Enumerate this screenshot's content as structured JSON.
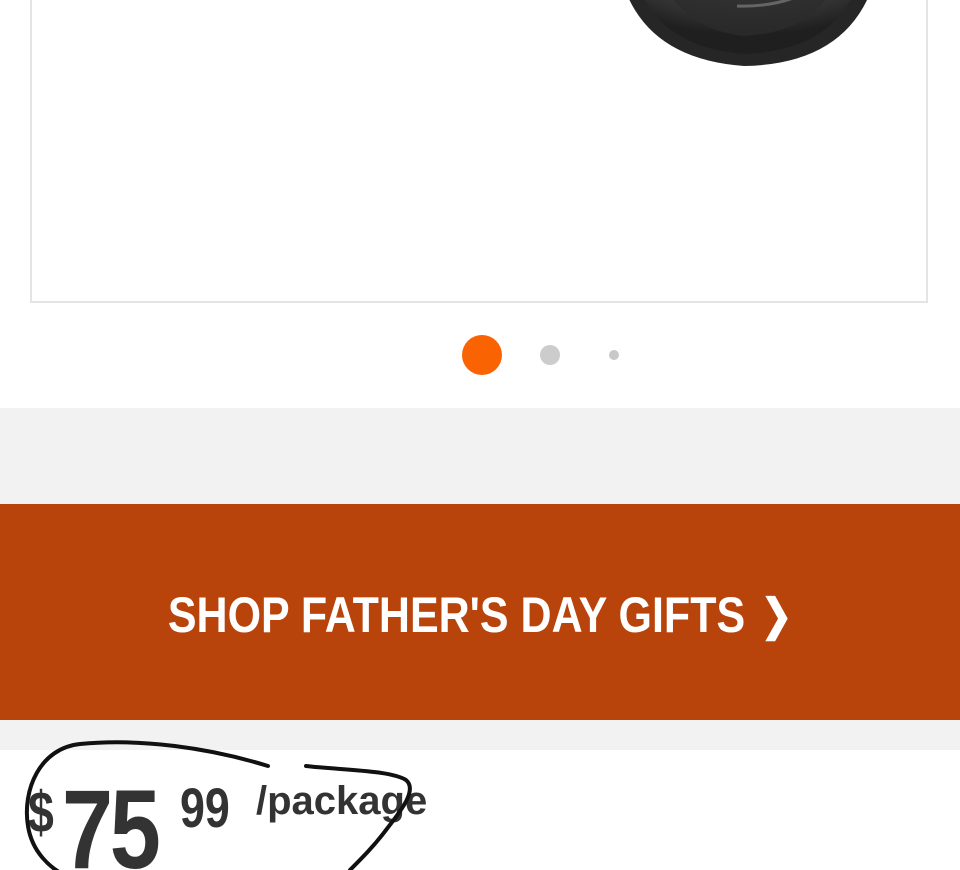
{
  "carousel": {
    "image_alt": "Product image",
    "page_count": 3,
    "active_index": 0,
    "active_color": "#f96302",
    "inactive_color": "#cccccc"
  },
  "promo": {
    "label": "SHOP FATHER'S DAY GIFTS",
    "chevron": "❯",
    "background": "#b9440b"
  },
  "price": {
    "currency": "$",
    "dollars": "75",
    "cents": "99",
    "unit": "/package"
  },
  "annotation": {
    "color": "#111111",
    "type": "hand-drawn-circle"
  }
}
